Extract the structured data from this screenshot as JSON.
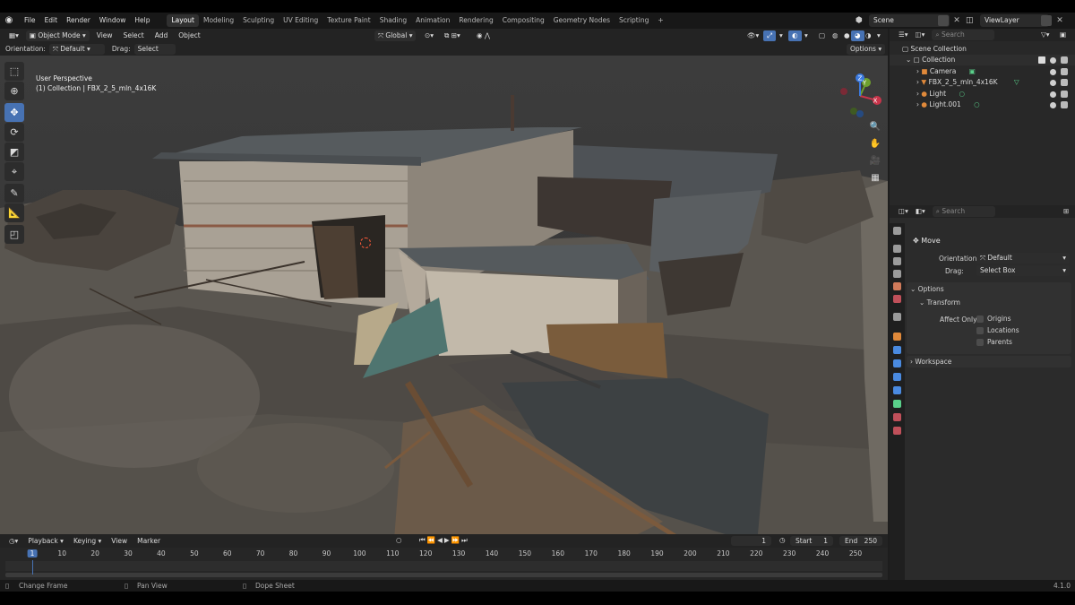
{
  "top_menu": [
    "File",
    "Edit",
    "Render",
    "Window",
    "Help"
  ],
  "workspaces": [
    {
      "label": "Layout",
      "active": true
    },
    {
      "label": "Modeling"
    },
    {
      "label": "Sculpting"
    },
    {
      "label": "UV Editing"
    },
    {
      "label": "Texture Paint"
    },
    {
      "label": "Shading"
    },
    {
      "label": "Animation"
    },
    {
      "label": "Rendering"
    },
    {
      "label": "Compositing"
    },
    {
      "label": "Geometry Nodes"
    },
    {
      "label": "Scripting"
    }
  ],
  "add_workspace": "+",
  "scene": "Scene",
  "view_layer": "ViewLayer",
  "viewport_header": {
    "mode": "Object Mode",
    "menus": [
      "View",
      "Select",
      "Add",
      "Object"
    ],
    "transform_orientation": "Global"
  },
  "tool_settings": {
    "orientation_label": "Orientation:",
    "orientation_value": "Default",
    "drag_label": "Drag:",
    "drag_value": "Select Box",
    "options": "Options"
  },
  "viewport": {
    "view_name": "User Perspective",
    "collection_info": "(1) Collection | FBX_2_5_mln_4x16K",
    "gizmo_axes": [
      "X",
      "Y",
      "Z"
    ]
  },
  "timeline": {
    "menus": [
      "Playback",
      "Keying",
      "View",
      "Marker"
    ],
    "current_frame": "1",
    "start_label": "Start",
    "start": "1",
    "end_label": "End",
    "end": "250",
    "ticks": [
      "1",
      "10",
      "20",
      "30",
      "40",
      "50",
      "60",
      "70",
      "80",
      "90",
      "100",
      "110",
      "120",
      "130",
      "140",
      "150",
      "160",
      "170",
      "180",
      "190",
      "200",
      "210",
      "220",
      "230",
      "240",
      "250"
    ]
  },
  "status_bar": {
    "left_hint": "Change Frame",
    "middle_hint": "Pan View",
    "right_hint": "Dope Sheet",
    "version": "4.1.0"
  },
  "outliner": {
    "search_placeholder": "Search",
    "root": "Scene Collection",
    "collection": "Collection",
    "items": [
      {
        "name": "Camera",
        "color": "#e0893a"
      },
      {
        "name": "FBX_2_5_mln_4x16K",
        "color": "#e0893a"
      },
      {
        "name": "Light",
        "color": "#e0893a"
      },
      {
        "name": "Light.001",
        "color": "#e0893a"
      }
    ]
  },
  "properties": {
    "search_placeholder": "Search",
    "tool_name": "Move",
    "orientation_label": "Orientation",
    "orientation_value": "Default",
    "drag_label": "Drag:",
    "drag_value": "Select Box",
    "options_panel": "Options",
    "transform_subpanel": "Transform",
    "affect_only_label": "Affect Only",
    "affect_only": [
      "Origins",
      "Locations",
      "Parents"
    ],
    "workspace_panel": "Workspace"
  },
  "colors": {
    "accent": "#4772b3",
    "x_axis": "#c8344a",
    "y_axis": "#6ea02e",
    "z_axis": "#3b7ae0",
    "object_orange": "#e0893a"
  }
}
